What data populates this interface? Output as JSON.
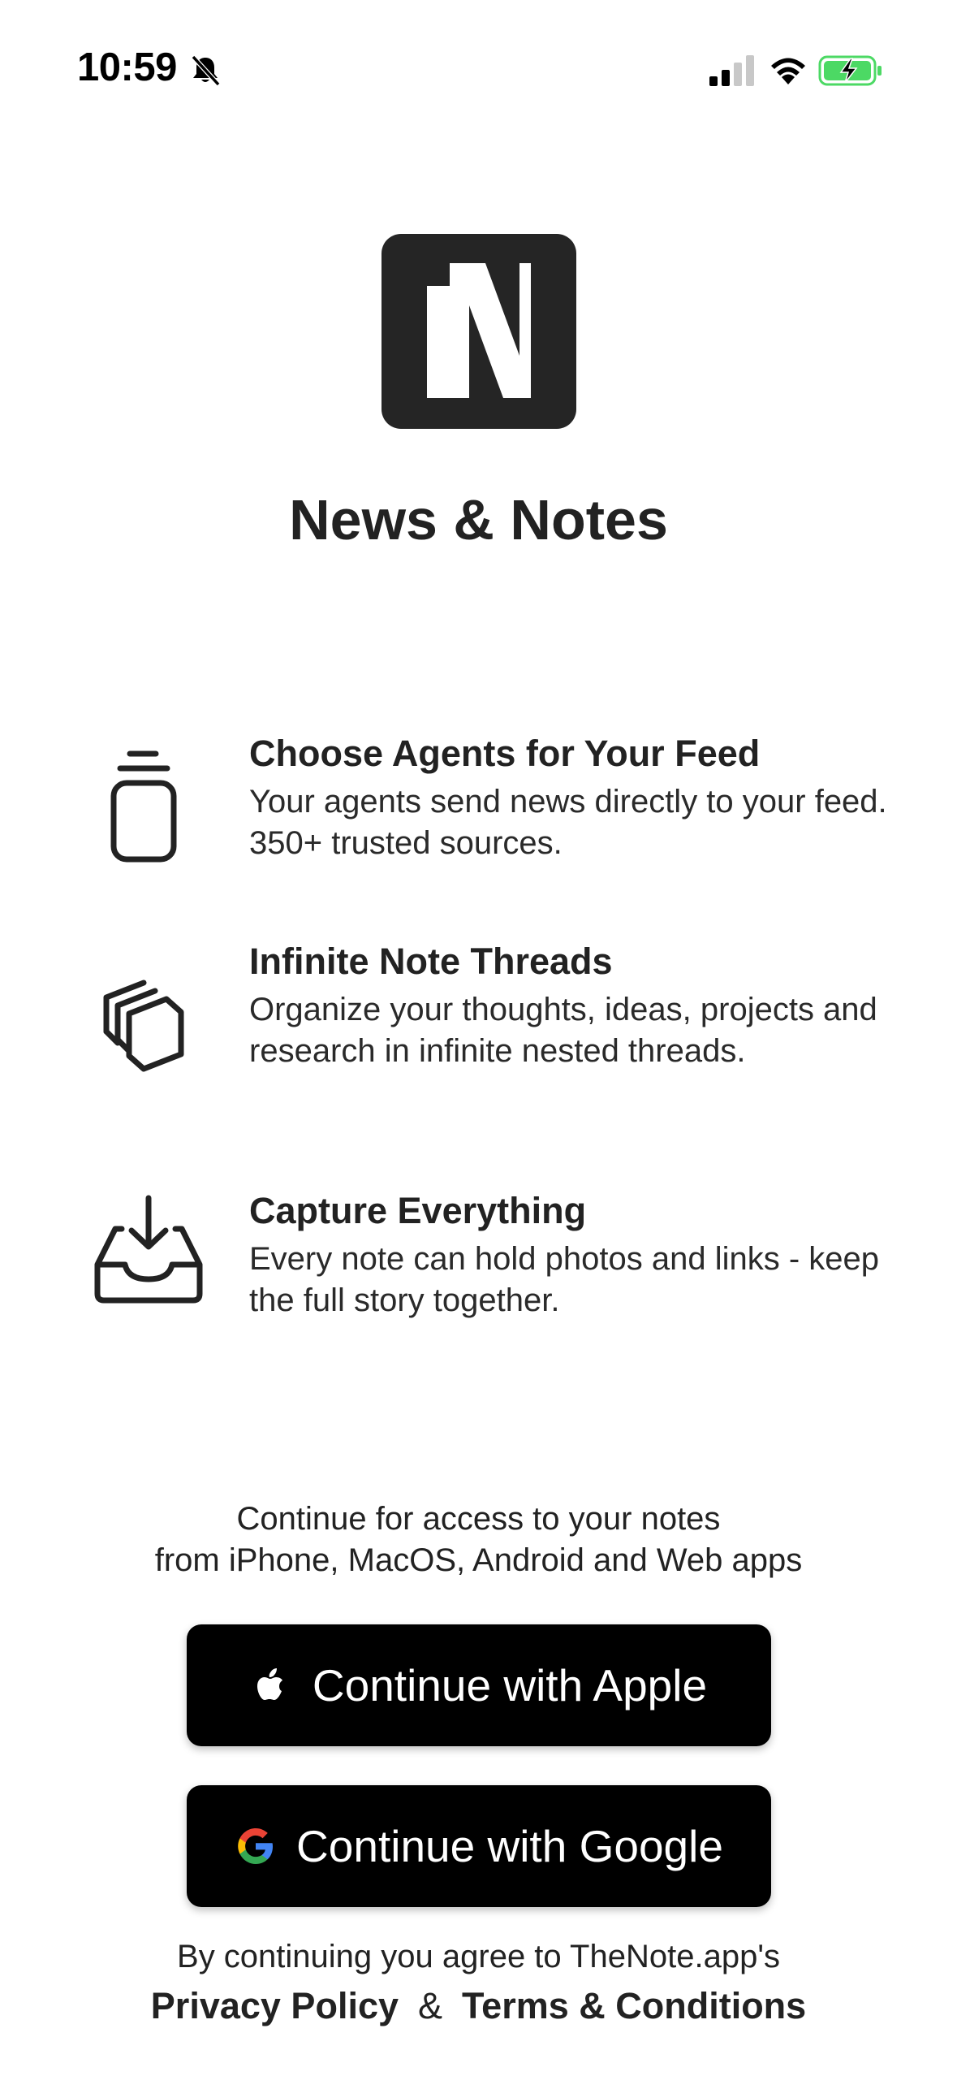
{
  "status_bar": {
    "time": "10:59",
    "icons": [
      "bell-slash-icon",
      "signal-icon",
      "wifi-icon",
      "battery-charging-icon"
    ],
    "battery_color": "#4cd964"
  },
  "app": {
    "logo_letter": "N",
    "title": "News & Notes"
  },
  "features": [
    {
      "icon": "jar-icon",
      "title": "Choose Agents for Your Feed",
      "description": "Your agents send news directly to your feed. 350+ trusted sources."
    },
    {
      "icon": "stacked-layers-icon",
      "title": "Infinite Note Threads",
      "description": "Organize your thoughts, ideas, projects and research in infinite nested threads."
    },
    {
      "icon": "inbox-download-icon",
      "title": "Capture Everything",
      "description": "Every note can hold photos and links - keep the full story together."
    }
  ],
  "continue_info": {
    "line1": "Continue for access to your notes",
    "line2": "from iPhone, MacOS, Android and Web apps"
  },
  "buttons": {
    "apple_label": "Continue with Apple",
    "google_label": "Continue with Google"
  },
  "legal": {
    "prefix": "By continuing you agree to TheNote.app's",
    "privacy": "Privacy Policy",
    "amp": "&",
    "terms": "Terms & Conditions"
  },
  "colors": {
    "background": "#ffffff",
    "text": "#222222",
    "button": "#000000",
    "logo_bg": "#252525"
  }
}
